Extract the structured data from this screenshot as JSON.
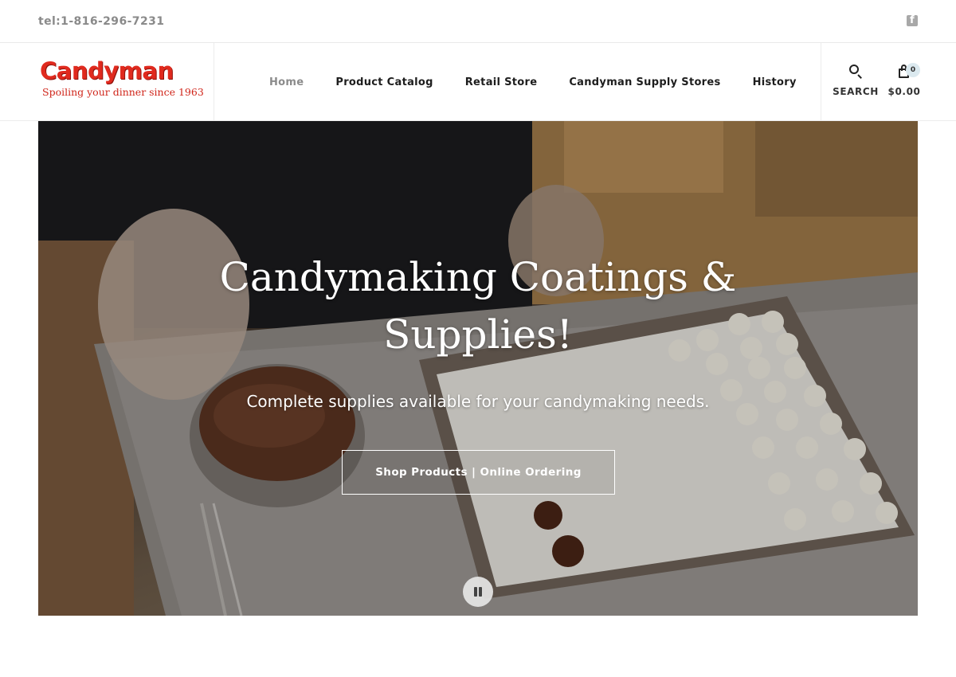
{
  "topbar": {
    "phone": "tel:1-816-296-7231"
  },
  "logo": {
    "name": "Candyman",
    "tagline": "Spoiling your dinner since 1963"
  },
  "nav": {
    "items": [
      {
        "label": "Home",
        "active": true
      },
      {
        "label": "Product Catalog",
        "active": false
      },
      {
        "label": "Retail Store",
        "active": false
      },
      {
        "label": "Candyman Supply Stores",
        "active": false
      },
      {
        "label": "History",
        "active": false
      }
    ]
  },
  "tools": {
    "search_label": "SEARCH",
    "cart_total": "$0.00",
    "cart_count": "0"
  },
  "hero": {
    "title_line1": "Candymaking Coatings &",
    "title_line2": "Supplies!",
    "subtitle": "Complete supplies available for your candymaking needs.",
    "button_label": "Shop Products | Online Ordering"
  },
  "colors": {
    "brand_red": "#e02a1e",
    "nav_active": "#8b8b8b",
    "badge_bg": "#dbe9ef"
  },
  "icons": {
    "social": "facebook-icon",
    "search": "search-icon",
    "cart": "shopping-bag-icon",
    "video_control": "pause-icon"
  }
}
